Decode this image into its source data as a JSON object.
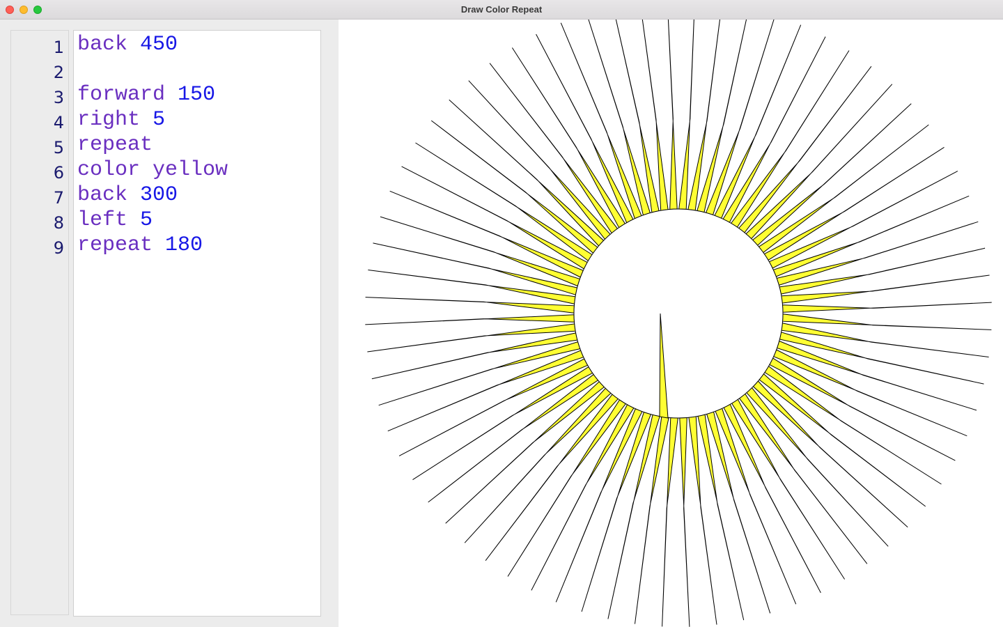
{
  "window": {
    "title": "Draw Color Repeat"
  },
  "editor": {
    "lines": [
      {
        "number": "1",
        "keyword": "back",
        "arg": "450"
      },
      {
        "number": "2",
        "keyword": "",
        "arg": ""
      },
      {
        "number": "3",
        "keyword": "forward",
        "arg": "150"
      },
      {
        "number": "4",
        "keyword": "right",
        "arg": "5"
      },
      {
        "number": "5",
        "keyword": "repeat",
        "arg": ""
      },
      {
        "number": "6",
        "keyword": "color yellow",
        "arg": ""
      },
      {
        "number": "7",
        "keyword": "back",
        "arg": "300"
      },
      {
        "number": "8",
        "keyword": "left",
        "arg": "5"
      },
      {
        "number": "9",
        "keyword": "repeat",
        "arg": "180"
      }
    ]
  },
  "canvas": {
    "fill_color": "#ffff33",
    "stroke_color": "#000000",
    "spike_count": 72,
    "background": "#ffffff"
  },
  "colors": {
    "keyword": "#6a2fc0",
    "number": "#1717e6",
    "line_number": "#1a1a6e"
  }
}
